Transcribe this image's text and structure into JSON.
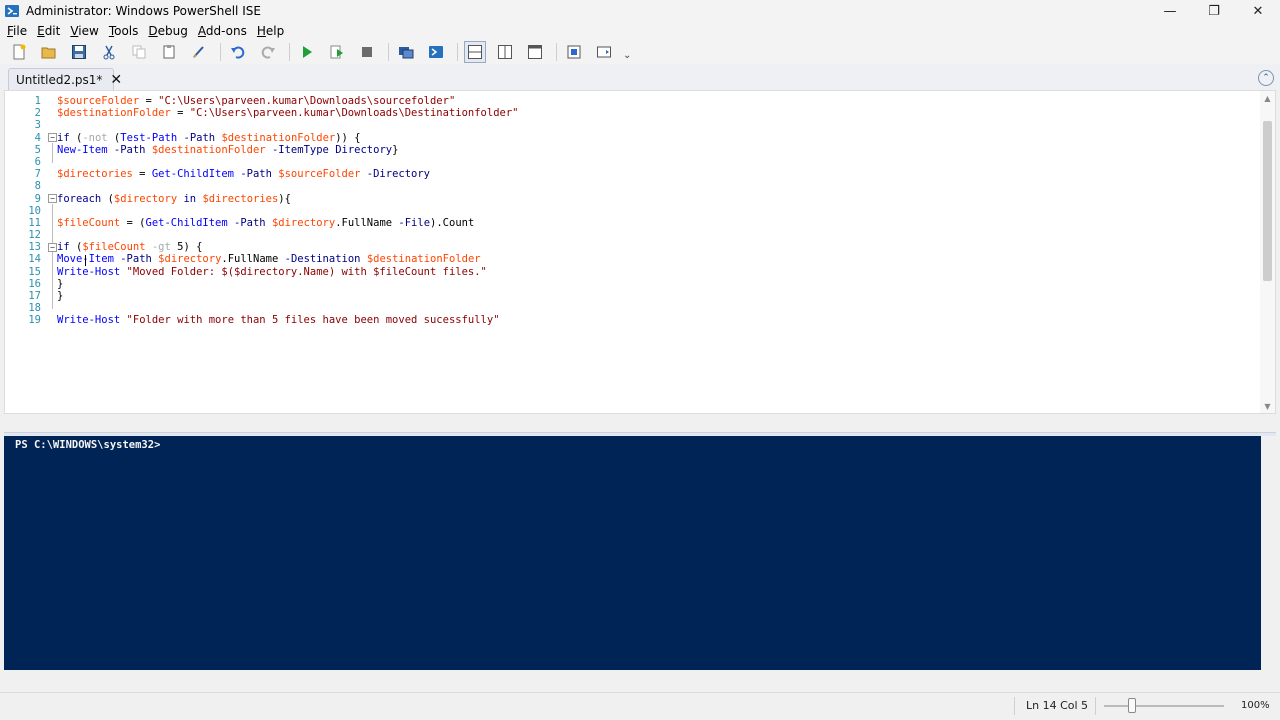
{
  "window": {
    "title": "Administrator: Windows PowerShell ISE",
    "minimize": "—",
    "restore": "❐",
    "close": "✕"
  },
  "menu": [
    {
      "first": "F",
      "rest": "ile"
    },
    {
      "first": "E",
      "rest": "dit"
    },
    {
      "first": "V",
      "rest": "iew"
    },
    {
      "first": "T",
      "rest": "ools"
    },
    {
      "first": "D",
      "rest": "ebug"
    },
    {
      "first": "A",
      "rest": "dd-ons"
    },
    {
      "first": "H",
      "rest": "elp"
    }
  ],
  "toolbar": {
    "icons": [
      "new-icon",
      "open-icon",
      "save-icon",
      "cut-icon",
      "copy-icon",
      "paste-icon",
      "clear-console-icon",
      "undo-icon",
      "redo-icon",
      "run-icon",
      "run-selection-icon",
      "stop-icon",
      "remote-powershell-icon",
      "powershell-icon",
      "layout-top-icon",
      "layout-right-icon",
      "layout-max-icon",
      "command-addon-icon",
      "show-script-pane-icon"
    ],
    "overflow": "⌄"
  },
  "tab": {
    "label": "Untitled2.ps1*",
    "close": "✕",
    "collapse": "⌃"
  },
  "editor": {
    "line_numbers": [
      "1",
      "2",
      "3",
      "4",
      "5",
      "6",
      "7",
      "8",
      "9",
      "10",
      "11",
      "12",
      "13",
      "14",
      "15",
      "16",
      "17",
      "18",
      "19"
    ],
    "lines": [
      [
        {
          "t": "$sourceFolder",
          "c": "var"
        },
        {
          "t": " = ",
          "c": "plain"
        },
        {
          "t": "\"C:\\Users\\parveen.kumar\\Downloads\\sourcefolder\"",
          "c": "str"
        }
      ],
      [
        {
          "t": "$destinationFolder",
          "c": "var"
        },
        {
          "t": " = ",
          "c": "plain"
        },
        {
          "t": "\"C:\\Users\\parveen.kumar\\Downloads\\Destinationfolder\"",
          "c": "str"
        }
      ],
      [],
      [
        {
          "t": "if",
          "c": "kw"
        },
        {
          "t": " (",
          "c": "plain"
        },
        {
          "t": "-not",
          "c": "op"
        },
        {
          "t": " (",
          "c": "plain"
        },
        {
          "t": "Test-Path",
          "c": "cmd"
        },
        {
          "t": " -Path ",
          "c": "prm"
        },
        {
          "t": "$destinationFolder",
          "c": "var"
        },
        {
          "t": ")) {",
          "c": "plain"
        }
      ],
      [
        {
          "t": "New-Item",
          "c": "cmd"
        },
        {
          "t": " -Path ",
          "c": "prm"
        },
        {
          "t": "$destinationFolder",
          "c": "var"
        },
        {
          "t": " -ItemType ",
          "c": "prm"
        },
        {
          "t": "Directory",
          "c": "kw"
        },
        {
          "t": "}",
          "c": "plain"
        }
      ],
      [],
      [
        {
          "t": "$directories",
          "c": "var"
        },
        {
          "t": " = ",
          "c": "plain"
        },
        {
          "t": "Get-ChildItem",
          "c": "cmd"
        },
        {
          "t": " -Path ",
          "c": "prm"
        },
        {
          "t": "$sourceFolder",
          "c": "var"
        },
        {
          "t": " -Directory",
          "c": "prm"
        }
      ],
      [],
      [
        {
          "t": "foreach",
          "c": "kw"
        },
        {
          "t": " (",
          "c": "plain"
        },
        {
          "t": "$directory",
          "c": "var"
        },
        {
          "t": " in ",
          "c": "kw"
        },
        {
          "t": "$directories",
          "c": "var"
        },
        {
          "t": "){",
          "c": "plain"
        }
      ],
      [],
      [
        {
          "t": "$fileCount",
          "c": "var"
        },
        {
          "t": " = (",
          "c": "plain"
        },
        {
          "t": "Get-ChildItem",
          "c": "cmd"
        },
        {
          "t": " -Path ",
          "c": "prm"
        },
        {
          "t": "$directory",
          "c": "var"
        },
        {
          "t": ".FullName",
          "c": "mem"
        },
        {
          "t": " -File",
          "c": "prm"
        },
        {
          "t": ").Count",
          "c": "plain"
        }
      ],
      [],
      [
        {
          "t": "if",
          "c": "kw"
        },
        {
          "t": " (",
          "c": "plain"
        },
        {
          "t": "$fileCount",
          "c": "var"
        },
        {
          "t": " -gt ",
          "c": "op"
        },
        {
          "t": "5",
          "c": "plain"
        },
        {
          "t": ") {",
          "c": "plain"
        }
      ],
      [
        {
          "t": "Move-Item",
          "c": "cmd"
        },
        {
          "t": " -Path ",
          "c": "prm"
        },
        {
          "t": "$directory",
          "c": "var"
        },
        {
          "t": ".FullName",
          "c": "mem"
        },
        {
          "t": " -Destination ",
          "c": "prm"
        },
        {
          "t": "$destinationFolder",
          "c": "var"
        }
      ],
      [
        {
          "t": "Write-Host",
          "c": "cmd"
        },
        {
          "t": " ",
          "c": "plain"
        },
        {
          "t": "\"Moved Folder: $($directory.Name) with $fileCount files.\"",
          "c": "str"
        }
      ],
      [
        {
          "t": "}",
          "c": "plain"
        }
      ],
      [
        {
          "t": "}",
          "c": "plain"
        }
      ],
      [],
      [
        {
          "t": "Write-Host",
          "c": "cmd"
        },
        {
          "t": " ",
          "c": "plain"
        },
        {
          "t": "\"Folder with more than 5 files have been moved sucessfully\"",
          "c": "str"
        }
      ]
    ]
  },
  "console": {
    "prompt": "PS C:\\WINDOWS\\system32>"
  },
  "status": {
    "position": "Ln 14  Col 5",
    "zoom": "100%"
  }
}
